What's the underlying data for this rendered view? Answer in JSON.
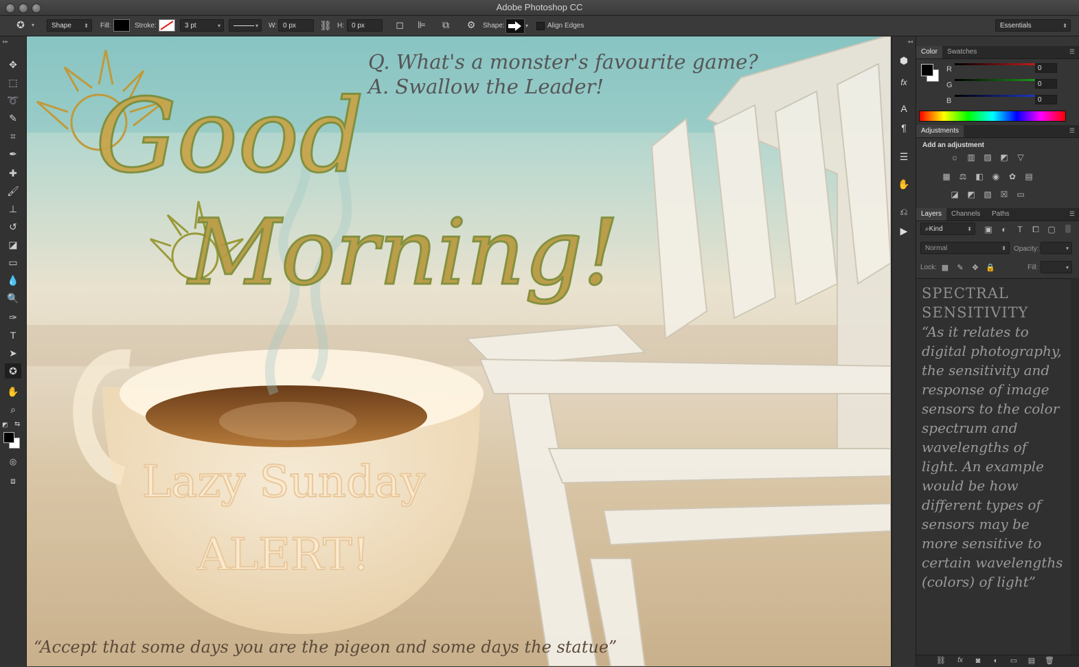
{
  "window": {
    "title": "Adobe Photoshop CC"
  },
  "options_bar": {
    "tool_mode": "Shape",
    "fill_label": "Fill:",
    "stroke_label": "Stroke:",
    "stroke_width": "3 pt",
    "w_label": "W:",
    "w_value": "0 px",
    "h_label": "H:",
    "h_value": "0 px",
    "shape_label": "Shape:",
    "align_edges_label": "Align Edges",
    "workspace": "Essentials"
  },
  "canvas": {
    "joke_q": "Q. What's a monster's favourite game?",
    "joke_a": "A. Swallow the Leader!",
    "headline_1": "Good",
    "headline_2": "Morning!",
    "cup_line_1": "Lazy Sunday",
    "cup_line_2": "ALERT!",
    "quote": "“Accept that some days you are the pigeon and some days the statue”"
  },
  "color_panel": {
    "tabs": [
      "Color",
      "Swatches"
    ],
    "r_label": "R",
    "g_label": "G",
    "b_label": "B",
    "r_value": "0",
    "g_value": "0",
    "b_value": "0"
  },
  "adjustments_panel": {
    "tab": "Adjustments",
    "heading": "Add an adjustment"
  },
  "layers_panel": {
    "tabs": [
      "Layers",
      "Channels",
      "Paths"
    ],
    "filter_kind": "Kind",
    "blend_mode": "Normal",
    "opacity_label": "Opacity:",
    "lock_label": "Lock:",
    "fill_label": "Fill:",
    "text_title": "SPECTRAL SENSITIVITY",
    "text_body": "“As it relates to digital photography, the sensitivity and response of image sensors to the color spectrum and wavelengths of light. An example would be how different types of sensors may be more sensitive to certain wavelengths (colors) of light”"
  },
  "colors": {
    "headline": "#b8923a",
    "headline_outline": "#7a8a3a",
    "exclamation": "#d49a3a",
    "slider_r": "#e02020",
    "slider_g": "#20b020",
    "slider_b": "#2040e0"
  }
}
